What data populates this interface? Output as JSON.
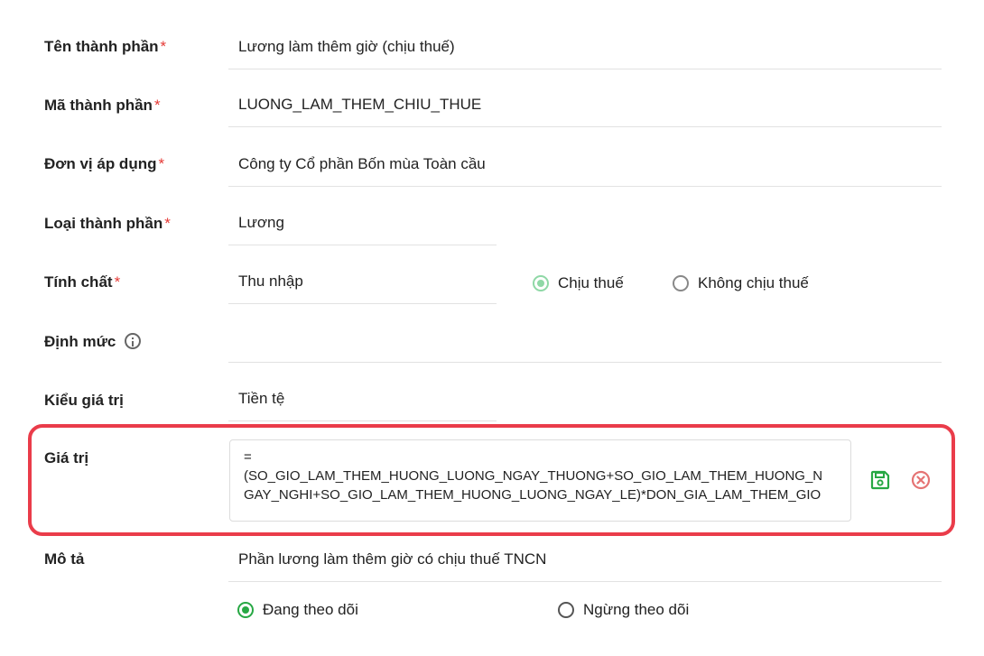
{
  "fields": {
    "ten": {
      "label": "Tên thành phần",
      "required": "*",
      "value": "Lương làm thêm giờ (chịu thuế)"
    },
    "ma": {
      "label": "Mã thành phần",
      "required": "*",
      "value": "LUONG_LAM_THEM_CHIU_THUE"
    },
    "donvi": {
      "label": "Đơn vị áp dụng",
      "required": "*",
      "value": "Công ty Cổ phần Bốn mùa Toàn cầu"
    },
    "loai": {
      "label": "Loại thành phần",
      "required": "*",
      "value": "Lương"
    },
    "tinhchat": {
      "label": "Tính chất",
      "required": "*",
      "value": "Thu nhập",
      "options": [
        "Chịu thuế",
        "Không chịu thuế"
      ],
      "selected": "Chịu thuế"
    },
    "dinhmuc": {
      "label": "Định mức",
      "value": ""
    },
    "kieu": {
      "label": "Kiểu giá trị",
      "value": "Tiền tệ"
    },
    "giatri": {
      "label": "Giá trị",
      "line1": "=",
      "line2": "(SO_GIO_LAM_THEM_HUONG_LUONG_NGAY_THUONG+SO_GIO_LAM_THEM_HUONG_N",
      "line3": "GAY_NGHI+SO_GIO_LAM_THEM_HUONG_LUONG_NGAY_LE)*DON_GIA_LAM_THEM_GIO"
    },
    "mota": {
      "label": "Mô tả",
      "value": "Phần lương làm thêm giờ có chịu thuế TNCN"
    }
  },
  "status": {
    "options": [
      "Đang theo dõi",
      "Ngừng theo dõi"
    ],
    "selected": "Đang theo dõi"
  },
  "icons": {
    "save": "save-icon",
    "cancel": "cancel-icon",
    "info": "info-icon"
  },
  "colors": {
    "required": "#e53935",
    "accent": "#27a844",
    "highlight": "#ea3c4a",
    "cancel": "#e57373"
  }
}
